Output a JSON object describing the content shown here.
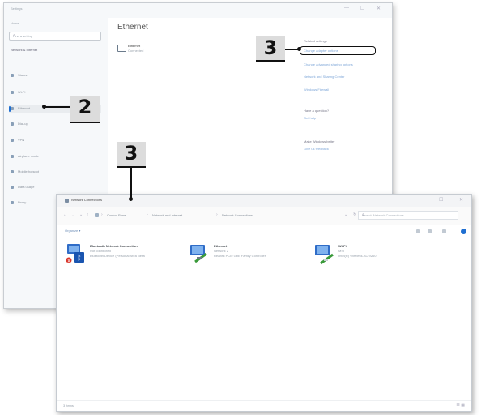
{
  "settings": {
    "app_title": "Settings",
    "window_controls": [
      "—",
      "☐",
      "✕"
    ],
    "sidebar": {
      "back_label": "Home",
      "search_placeholder": "Find a setting",
      "section_label": "Network & Internet",
      "items": [
        {
          "label": "Status"
        },
        {
          "label": "Wi-Fi"
        },
        {
          "label": "Ethernet"
        },
        {
          "label": "Dial-up"
        },
        {
          "label": "VPN"
        },
        {
          "label": "Airplane mode"
        },
        {
          "label": "Mobile hotspot"
        },
        {
          "label": "Data usage"
        },
        {
          "label": "Proxy"
        }
      ]
    },
    "page_title": "Ethernet",
    "connection": {
      "name": "Ethernet",
      "status": "Connected"
    },
    "related_settings": {
      "title": "Related settings",
      "links": [
        "Change adapter options",
        "Change advanced sharing options",
        "Network and Sharing Center",
        "Windows Firewall"
      ]
    },
    "question": {
      "title": "Have a question?",
      "link": "Get help"
    },
    "improve": {
      "title": "Make Windows better",
      "link": "Give us feedback"
    }
  },
  "network_connections": {
    "window_title": "Network Connections",
    "window_controls": [
      "—",
      "☐",
      "✕"
    ],
    "nav_buttons": [
      "←",
      "→",
      "⌄",
      "↑"
    ],
    "breadcrumb": [
      "Control Panel",
      "Network and Internet",
      "Network Connections"
    ],
    "search_placeholder": "Search Network Connections",
    "toolbar": {
      "organize": "Organize ▾"
    },
    "adapters": [
      {
        "name": "Bluetooth Network Connection",
        "status": "Not connected",
        "device": "Bluetooth Device (Personal Area Netw"
      },
      {
        "name": "Ethernet",
        "status": "Network 2",
        "device": "Realtek PCIe GbE Family Controller"
      },
      {
        "name": "Wi-Fi",
        "status": "MSI",
        "device": "Intel(R) Wireless-AC 9260"
      }
    ],
    "status_bar": {
      "items": "3 items",
      "views": "☷ ▦"
    }
  },
  "callouts": [
    {
      "number": "2"
    },
    {
      "number": "3"
    },
    {
      "number": "3"
    }
  ],
  "colors": {
    "accent": "#1f6fd1",
    "callout_bg": "#dcdcdc",
    "callout_text": "#111111"
  }
}
